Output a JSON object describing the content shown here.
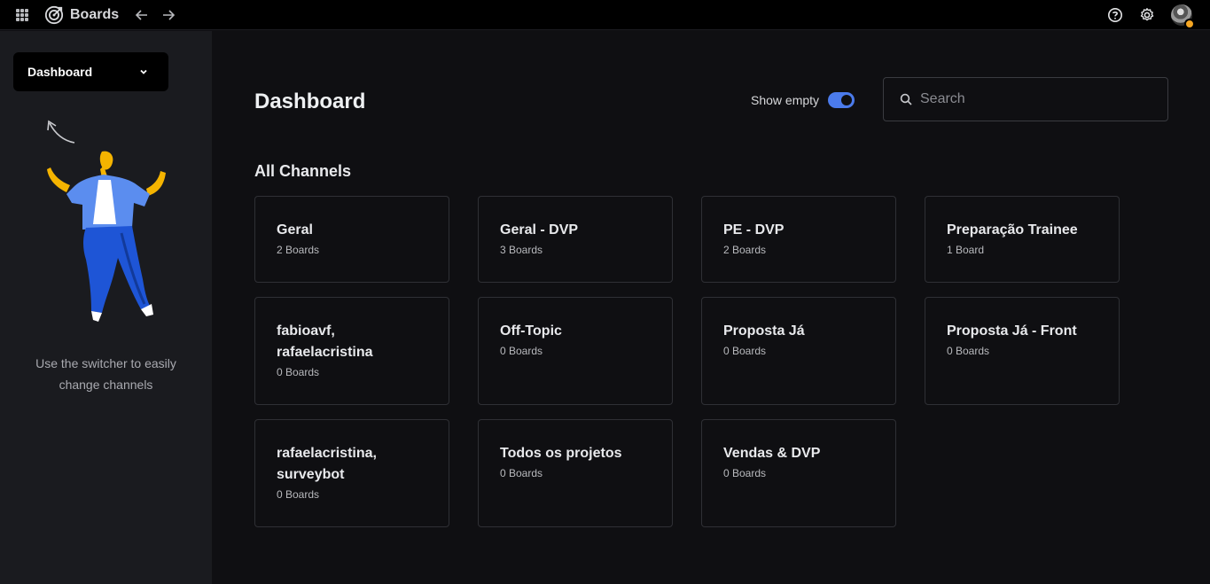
{
  "topbar": {
    "app_title": "Boards",
    "icons": {
      "apps": "grid-icon",
      "logo": "target-logo-icon",
      "back": "arrow-left-icon",
      "forward": "arrow-right-icon",
      "help": "help-circle-icon",
      "settings": "gear-icon",
      "avatar": "user-avatar"
    }
  },
  "sidebar": {
    "switcher_label": "Dashboard",
    "hint_line1": "Use the switcher to easily",
    "hint_line2": "change channels"
  },
  "main": {
    "title": "Dashboard",
    "show_empty_label": "Show empty",
    "show_empty_on": true,
    "search_placeholder": "Search",
    "section_title": "All Channels",
    "cards": [
      {
        "title": "Geral",
        "count": "2 Boards"
      },
      {
        "title": "Geral - DVP",
        "count": "3 Boards"
      },
      {
        "title": "PE - DVP",
        "count": "2 Boards"
      },
      {
        "title": "Preparação Trainee",
        "count": "1 Board"
      },
      {
        "title": "fabioavf, rafaelacristina",
        "count": "0 Boards"
      },
      {
        "title": "Off-Topic",
        "count": "0 Boards"
      },
      {
        "title": "Proposta Já",
        "count": "0 Boards"
      },
      {
        "title": "Proposta Já - Front",
        "count": "0 Boards"
      },
      {
        "title": "rafaelacristina, surveybot",
        "count": "0 Boards"
      },
      {
        "title": "Todos os projetos",
        "count": "0 Boards"
      },
      {
        "title": "Vendas & DVP",
        "count": "0 Boards"
      }
    ]
  },
  "colors": {
    "accent": "#4b7bec",
    "background": "#0f0f12",
    "sidebar": "#1a1b1f",
    "badge": "#f5a623"
  }
}
